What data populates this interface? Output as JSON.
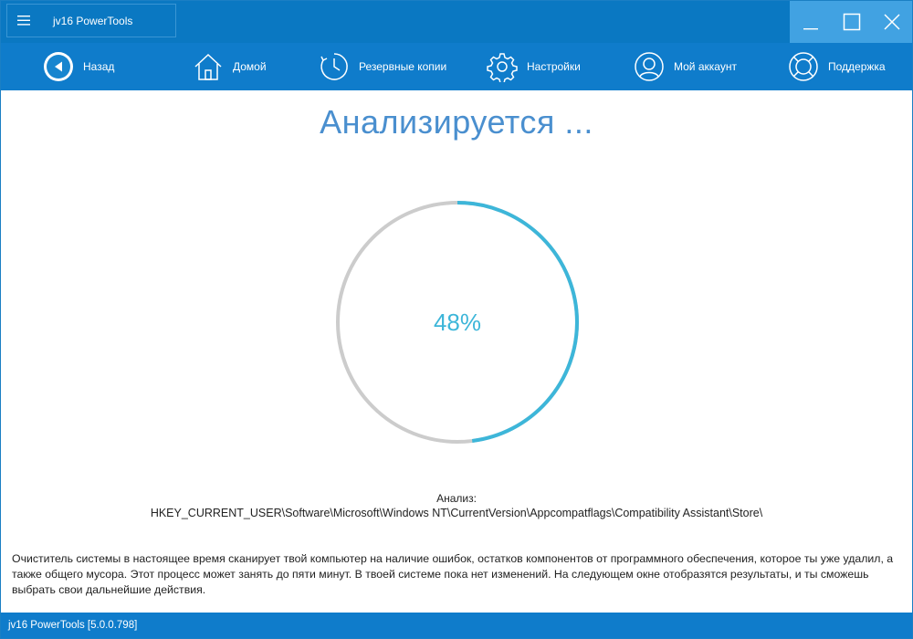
{
  "window": {
    "title": "jv16 PowerTools",
    "controls": {
      "minimize": "minimize",
      "maximize": "maximize",
      "close": "close"
    }
  },
  "nav": {
    "items": [
      {
        "label": "Назад",
        "icon": "back-arrow-icon"
      },
      {
        "label": "Домой",
        "icon": "home-icon"
      },
      {
        "label": "Резервные копии",
        "icon": "clock-icon"
      },
      {
        "label": "Настройки",
        "icon": "gear-icon"
      },
      {
        "label": "Мой аккаунт",
        "icon": "user-icon"
      },
      {
        "label": "Поддержка",
        "icon": "lifebuoy-icon"
      }
    ]
  },
  "main": {
    "heading": "Анализируется ...",
    "progress": {
      "value": 48,
      "label": "48%"
    },
    "analysis_label": "Анализ:",
    "analysis_path": "HKEY_CURRENT_USER\\Software\\Microsoft\\Windows NT\\CurrentVersion\\Appcompatflags\\Compatibility Assistant\\Store\\",
    "description": "Очиститель системы в настоящее время сканирует твой компьютер на наличие ошибок, остатков компонентов от программного обеспечения, которое ты уже удалил, а также общего мусора. Этот процесс может занять до пяти минут. В твоей системе пока нет изменений. На следующем окне отобразятся результаты, и ты сможешь выбрать свои дальнейшие действия."
  },
  "status_bar": {
    "text": "jv16 PowerTools [5.0.0.798]"
  },
  "colors": {
    "titlebar": "#0a78c2",
    "navbar": "#0f7ccb",
    "accent": "#3db6d9",
    "heading": "#4a8fcf",
    "track": "#cccccc"
  }
}
